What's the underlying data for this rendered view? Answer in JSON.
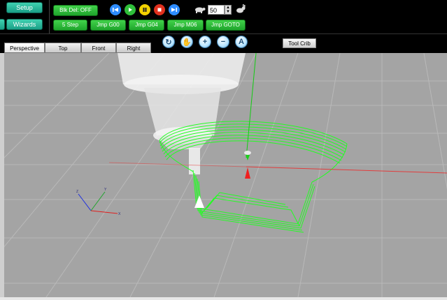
{
  "top_buttons": {
    "setup": "Setup",
    "wizards": "Wizards",
    "blk_del": "Blk Del: OFF",
    "step": "5 Step",
    "jmp_g00": "Jmp G00",
    "jmp_g04": "Jmp G04",
    "jmp_m06": "Jmp M06",
    "jmp_goto": "Jmp GOTO"
  },
  "controls": {
    "rewind_icon": "rewind-icon",
    "play_icon": "play-icon",
    "pause_icon": "pause-icon",
    "stop_icon": "stop-icon",
    "step_forward_icon": "step-forward-icon",
    "speed_value": "50"
  },
  "tabs": [
    {
      "label": "Perspective",
      "active": true
    },
    {
      "label": "Top",
      "active": false
    },
    {
      "label": "Front",
      "active": false
    },
    {
      "label": "Right",
      "active": false
    }
  ],
  "view_tools": [
    "rotate-icon",
    "pan-hand-icon",
    "zoom-in-icon",
    "zoom-out-icon",
    "zoom-fit-icon"
  ],
  "tool_crib": "Tool Crib",
  "axes": {
    "z": "Z",
    "y": "Y",
    "x": "X"
  },
  "colors": {
    "viewport_bg": "#a4a4a4",
    "toolpath": "#22ff22",
    "button_green": "#2fbf3a",
    "button_teal": "#2bb79a"
  }
}
